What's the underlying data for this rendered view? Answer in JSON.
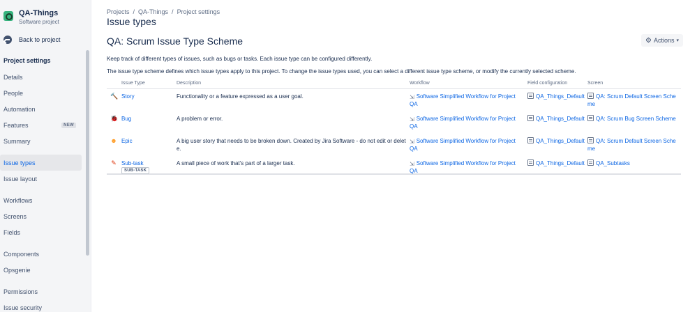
{
  "project": {
    "name": "QA-Things",
    "type": "Software project"
  },
  "sidebar": {
    "back_label": "Back to project",
    "heading": "Project settings",
    "items": [
      {
        "label": "Details"
      },
      {
        "label": "People"
      },
      {
        "label": "Automation"
      },
      {
        "label": "Features",
        "badge": "NEW"
      },
      {
        "label": "Summary"
      },
      {
        "label": "Issue types",
        "active": true
      },
      {
        "label": "Issue layout"
      },
      {
        "label": "Workflows"
      },
      {
        "label": "Screens"
      },
      {
        "label": "Fields"
      },
      {
        "label": "Components"
      },
      {
        "label": "Opsgenie"
      },
      {
        "label": "Permissions"
      },
      {
        "label": "Issue security"
      }
    ]
  },
  "breadcrumb": [
    "Projects",
    "QA-Things",
    "Project settings"
  ],
  "page_title": "Issue types",
  "scheme_title": "QA: Scrum Issue Type Scheme",
  "actions_label": "Actions",
  "description_1": "Keep track of different types of issues, such as bugs or tasks. Each issue type can be configured differently.",
  "description_2": "The issue type scheme defines which issue types apply to this project. To change the issue types used, you can select a different issue type scheme, or modify the currently selected scheme.",
  "table": {
    "headers": [
      "Issue Type",
      "Description",
      "Workflow",
      "Field configuration",
      "Screen"
    ],
    "rows": [
      {
        "type": "Story",
        "icon": "story-icon",
        "description": "Functionality or a feature expressed as a user goal.",
        "workflow": "Software Simplified Workflow for Project QA",
        "field_config": "QA_Things_Default",
        "screen": "QA: Scrum Default Screen Scheme"
      },
      {
        "type": "Bug",
        "icon": "bug-icon",
        "description": "A problem or error.",
        "workflow": "Software Simplified Workflow for Project QA",
        "field_config": "QA_Things_Default",
        "screen": "QA: Scrum Bug Screen Scheme"
      },
      {
        "type": "Epic",
        "icon": "epic-icon",
        "description": "A big user story that needs to be broken down. Created by Jira Software - do not edit or delete.",
        "workflow": "Software Simplified Workflow for Project QA",
        "field_config": "QA_Things_Default",
        "screen": "QA: Scrum Default Screen Scheme"
      },
      {
        "type": "Sub-task",
        "icon": "subtask-icon",
        "badge": "SUB-TASK",
        "description": "A small piece of work that's part of a larger task.",
        "workflow": "Software Simplified Workflow for Project QA",
        "field_config": "QA_Things_Default",
        "screen": "QA_Subtasks"
      }
    ]
  }
}
